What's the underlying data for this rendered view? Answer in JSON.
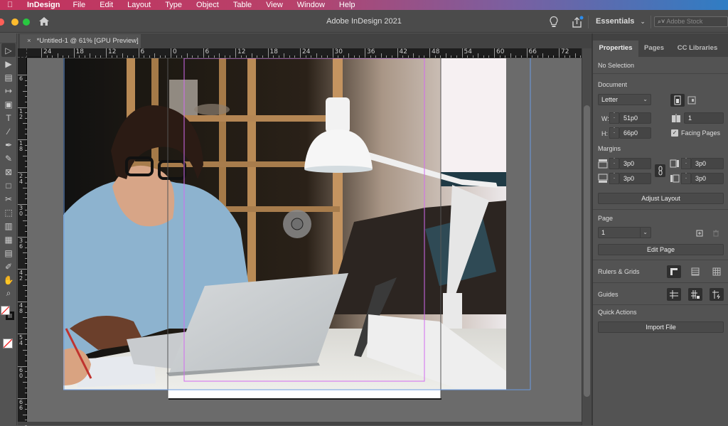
{
  "menubar": {
    "apple_icon": "",
    "app_name": "InDesign",
    "items": [
      "File",
      "Edit",
      "Layout",
      "Type",
      "Object",
      "Table",
      "View",
      "Window",
      "Help"
    ]
  },
  "titlebar": {
    "title": "Adobe InDesign 2021",
    "workspace": "Essentials",
    "workspace_chevron": "⌄",
    "stock_placeholder": "Adobe Stock",
    "stock_icon": "⌕˅",
    "traffic_colors": {
      "close": "#ff5f57",
      "minimize": "#febc2e",
      "zoom": "#28c840"
    },
    "share_badge_color": "#2d8ceb"
  },
  "document_tab": {
    "close": "×",
    "label": "*Untitled-1 @ 61% [GPU Preview]"
  },
  "tools": [
    {
      "name": "selection-tool",
      "icon": "▷"
    },
    {
      "name": "direct-selection-tool",
      "icon": "▶"
    },
    {
      "name": "page-tool",
      "icon": "▤"
    },
    {
      "name": "gap-tool",
      "icon": "↦"
    },
    {
      "name": "content-collector-tool",
      "icon": "▣"
    },
    {
      "name": "type-tool",
      "icon": "T"
    },
    {
      "name": "line-tool",
      "icon": "∕"
    },
    {
      "name": "pen-tool",
      "icon": "✒"
    },
    {
      "name": "pencil-tool",
      "icon": "✎"
    },
    {
      "name": "rectangle-frame-tool",
      "icon": "⊠"
    },
    {
      "name": "rectangle-tool",
      "icon": "□"
    },
    {
      "name": "scissors-tool",
      "icon": "✂"
    },
    {
      "name": "free-transform-tool",
      "icon": "⬚"
    },
    {
      "name": "gradient-swatch-tool",
      "icon": "▥"
    },
    {
      "name": "gradient-feather-tool",
      "icon": "▦"
    },
    {
      "name": "note-tool",
      "icon": "▤"
    },
    {
      "name": "eyedropper-tool",
      "icon": "✐"
    },
    {
      "name": "hand-tool",
      "icon": "✋"
    },
    {
      "name": "zoom-tool",
      "icon": "⌕"
    }
  ],
  "rulers": {
    "horizontal": [
      "24",
      "18",
      "12",
      "6",
      "0",
      "6",
      "12",
      "18",
      "24",
      "30",
      "36",
      "42",
      "48",
      "54",
      "60",
      "66",
      "72"
    ],
    "vertical": [
      "6",
      "12",
      "18",
      "24",
      "30",
      "36",
      "42",
      "48",
      "54",
      "60",
      "66"
    ]
  },
  "properties_panel": {
    "tabs": [
      "Properties",
      "Pages",
      "CC Libraries"
    ],
    "selection": "No Selection",
    "document_label": "Document",
    "page_size": "Letter",
    "width_label": "W:",
    "width": "51p0",
    "height_label": "H:",
    "height": "66p0",
    "pages_count": "1",
    "facing_pages_label": "Facing Pages",
    "facing_pages_checked": true,
    "margins_label": "Margins",
    "margin_top": "3p0",
    "margin_bottom": "3p0",
    "margin_inside": "3p0",
    "margin_outside": "3p0",
    "adjust_layout": "Adjust Layout",
    "page_label": "Page",
    "page_value": "1",
    "edit_page": "Edit Page",
    "rulers_grids_label": "Rulers & Grids",
    "guides_label": "Guides",
    "quick_actions_label": "Quick Actions",
    "import_file": "Import File"
  },
  "canvas": {
    "margin_guide_color": "#d36bf0",
    "bleed_color": "#6b9be0",
    "page_fill": "#ffffff"
  }
}
